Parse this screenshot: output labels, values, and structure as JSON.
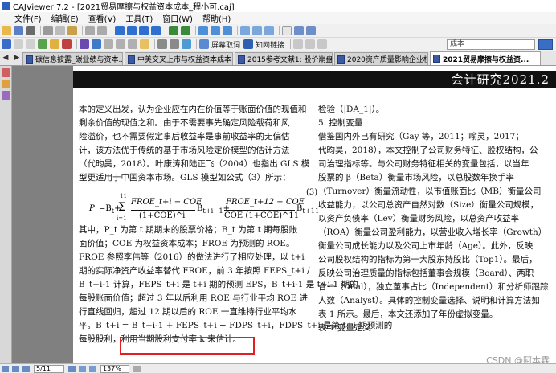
{
  "window": {
    "title": "CAJViewer 7.2 - [2021贸易摩擦与权益资本成本_程小可.caj]"
  },
  "menu": {
    "items": [
      "文件(F)",
      "编辑(E)",
      "查看(V)",
      "工具(T)",
      "窗口(W)",
      "帮助(H)"
    ]
  },
  "toolbar": {
    "screen_read_label": "屏幕取词",
    "knowledge_link_label": "知网链接",
    "search_value": "成本"
  },
  "tabs": [
    {
      "label": "碳信息披露_碳业绩与资本..."
    },
    {
      "label": "中美交叉上市与权益资本成本..."
    },
    {
      "label": "2015参考文献1: 股价崩盘风..."
    },
    {
      "label": "2020资产质量影响企业权益..."
    },
    {
      "label": "2021贸易摩擦与权益资..."
    }
  ],
  "page": {
    "header": "会计研究2021.2",
    "left_lines": [
      "本的定义出发，认为企业应在内在价值等于账面价值的现值和",
      "剩余价值的现值之和。由于不需要事先确定风险载荷和风",
      "险溢价，也不需要假定事后收益率是事前收益率的无偏估",
      "计，该方法优于传统的基于市场风险定价模型的估计方法",
      "（代昀昊，2018）。叶康涛和陆正飞（2004）也指出 GLS 模",
      "型更适用于中国资本市场。GLS 模型如公式（3）所示："
    ],
    "left_lines_2": [
      "其中，P_t 为第 t 期期末的股票价格；B_t 为第 t 期每股账",
      "面价值；COE 为权益资本成本；FROE 为预测的 ROE。",
      "FROE 参照李伟等（2016）的做法进行了相应处理，以 t+i",
      "期的实际净资产收益率替代 FROE，前 3 年按照 FEPS_t+i /",
      "B_t+i-1 计算，FEPS_t+i 是 t+i 期的预测 EPS，B_t+i-1 是 t+i-1 期的",
      "每股账面价值；超过 3 年以后利用 ROE 与行业平均 ROE 进",
      "行直线回归，超过 12 期以后的 ROE 一直维持行业平均水",
      "平。B_t+i = B_t+i-1 + FEPS_t+i − FDPS_t+i，FDPS_t+i 是第 t+i 期预测的",
      "每股股利，利用当期股利支付率 k 来估计。"
    ],
    "formula": {
      "lhs": "P",
      "term1_num": "FROE_t+i − COE",
      "term1_den": "(1+COE)^i",
      "term2_num": "FROE_t+12 − COE",
      "term2_den": "COE (1+COE)^11",
      "sum_top": "11",
      "sum_bottom": "i=1",
      "eq_no": "(3)"
    },
    "right_lines": [
      "检验（|DA_1|）。",
      "5. 控制变量",
      "借鉴国内外已有研究（Gay 等，2011；喻灵，2017；",
      "代昀昊，2018），本文控制了公司财务特征、股权结构，公",
      "司治理指标等。与公司财务特征相关的变量包括，以当年",
      "股票的 β（Beta）衡量市场风险，以总股数年换手率",
      "（Turnover）衡量流动性，以市值账面比（MB）衡量公司",
      "收益能力，以公司总资产自然对数（Size）衡量公司规模，",
      "以资产负债率（Lev）衡量财务风险，以总资产收益率",
      "（ROA）衡量公司盈利能力，以营业收入增长率（Growth）",
      "衡量公司成长能力以及公司上市年龄（Age）。此外，反映",
      "公司股权结构的指标为第一大股东持股比（Top1）。最后，",
      "反映公司治理质量的指标包括董事会规模（Board）、两职",
      "合一（Dual），独立董事占比（Independent）和分析师跟踪",
      "人数（Analyst）。具体的控制变量选择、说明和计算方法如",
      "表 1 所示。最后，本文还添加了年份虚拟变量。",
      "表 1            变量定义"
    ]
  },
  "statusbar": {
    "page_value": "5/11",
    "zoom_value": "137%"
  },
  "watermark": "CSDN @阿本霖"
}
